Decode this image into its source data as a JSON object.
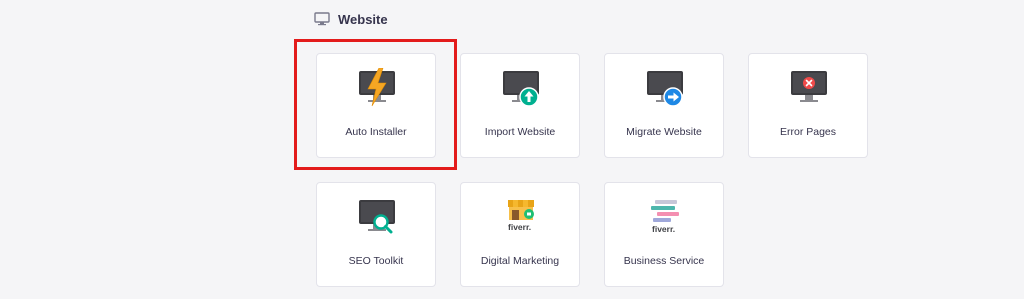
{
  "section": {
    "title": "Website",
    "icon": "monitor-icon"
  },
  "cards": [
    {
      "label": "Auto Installer",
      "icon": "lightning-monitor-icon"
    },
    {
      "label": "Import Website",
      "icon": "upload-monitor-icon"
    },
    {
      "label": "Migrate Website",
      "icon": "migrate-monitor-icon"
    },
    {
      "label": "Error Pages",
      "icon": "error-monitor-icon"
    },
    {
      "label": "SEO Toolkit",
      "icon": "seo-monitor-icon"
    },
    {
      "label": "Digital Marketing",
      "icon": "fiverr-store-icon",
      "brand": "fiverr."
    },
    {
      "label": "Business Service",
      "icon": "fiverr-list-icon",
      "brand": "fiverr."
    }
  ],
  "highlight_color": "#e31b1b"
}
